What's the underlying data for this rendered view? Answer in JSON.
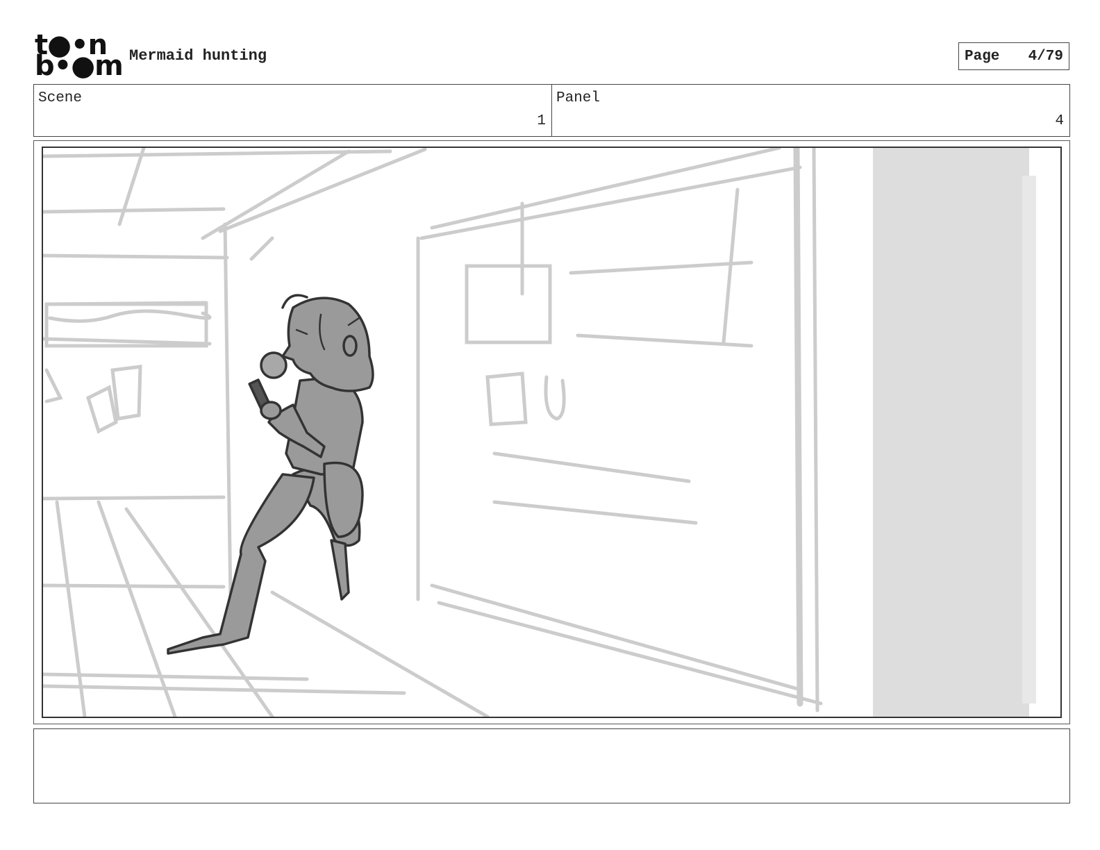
{
  "header": {
    "logo_line1": "t●•n",
    "logo_line2": "b•●m",
    "title": "Mermaid hunting",
    "page_label": "Page",
    "page_value": "4/79"
  },
  "info": {
    "scene_label": "Scene",
    "scene_value": "1",
    "panel_label": "Panel",
    "panel_value": "4"
  },
  "notes": {
    "text": ""
  },
  "colors": {
    "sketch_line": "#cccccc",
    "figure_fill": "#9a9a9a",
    "figure_outline": "#333333",
    "doorway": "#dddddd"
  }
}
